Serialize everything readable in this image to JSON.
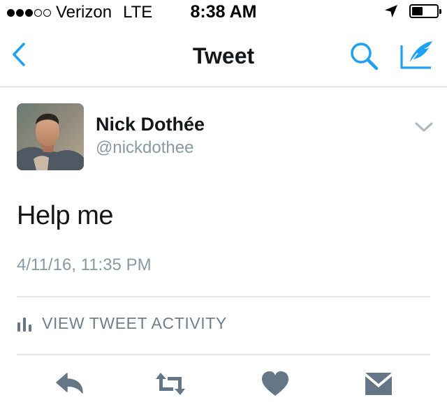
{
  "status_bar": {
    "carrier": "Verizon",
    "network": "LTE",
    "time": "8:38 AM",
    "signal_bars_filled": 3,
    "signal_bars_total": 5,
    "battery_level": 0.45
  },
  "nav": {
    "title": "Tweet",
    "icons": [
      "chevron-left-icon",
      "search-icon",
      "compose-icon"
    ],
    "accent_color": "#1da1f2"
  },
  "tweet": {
    "author_name": "Nick Dothée",
    "author_handle": "@nickdothee",
    "text": "Help me",
    "timestamp": "4/11/16, 11:35 PM"
  },
  "activity": {
    "label": "VIEW TWEET ACTIVITY",
    "icon": "bar-chart-icon"
  },
  "actions": {
    "icons": [
      "reply-icon",
      "retweet-icon",
      "like-icon",
      "direct-message-icon"
    ],
    "color": "#657786"
  }
}
